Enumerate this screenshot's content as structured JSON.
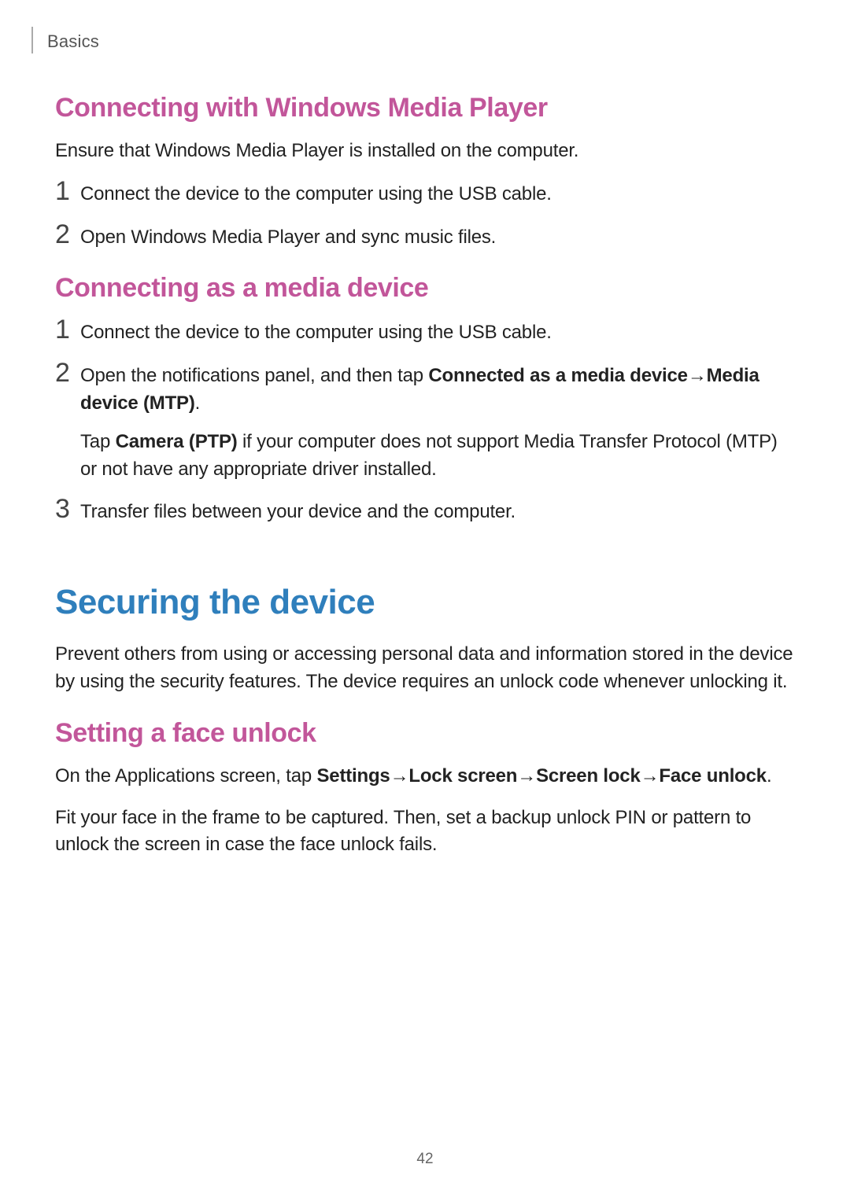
{
  "header": {
    "section": "Basics"
  },
  "sec1": {
    "heading": "Connecting with Windows Media Player",
    "intro": "Ensure that Windows Media Player is installed on the computer.",
    "steps": [
      "Connect the device to the computer using the USB cable.",
      "Open Windows Media Player and sync music files."
    ]
  },
  "sec2": {
    "heading": "Connecting as a media device",
    "steps": {
      "s1": "Connect the device to the computer using the USB cable.",
      "s2a": "Open the notifications panel, and then tap ",
      "s2b": "Connected as a media device",
      "s2arrow": " → ",
      "s2c": "Media device (MTP)",
      "s2d": ".",
      "s2e1": "Tap ",
      "s2e2": "Camera (PTP)",
      "s2e3": " if your computer does not support Media Transfer Protocol (MTP) or not have any appropriate driver installed.",
      "s3": "Transfer files between your device and the computer."
    }
  },
  "sec3": {
    "heading": "Securing the device",
    "intro": "Prevent others from using or accessing personal data and information stored in the device by using the security features. The device requires an unlock code whenever unlocking it.",
    "sub": {
      "heading": "Setting a face unlock",
      "p1a": "On the Applications screen, tap ",
      "p1b": "Settings",
      "p1arr": " → ",
      "p1c": "Lock screen",
      "p1d": "Screen lock",
      "p1e": "Face unlock",
      "p1f": ".",
      "p2": "Fit your face in the frame to be captured. Then, set a backup unlock PIN or pattern to unlock the screen in case the face unlock fails."
    }
  },
  "page_number": "42"
}
